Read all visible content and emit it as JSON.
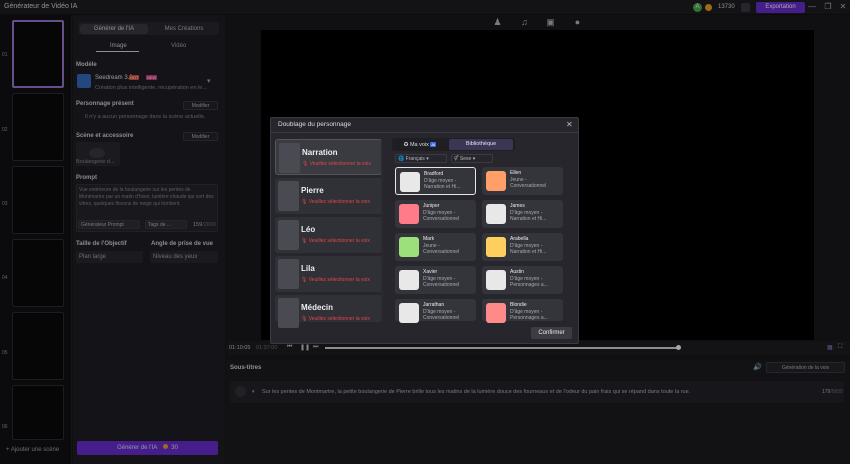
{
  "app": {
    "title": "Générateur de Vidéo IA",
    "avatar_letter": "A",
    "credits": "13730",
    "export_label": "Exportation"
  },
  "window": {
    "minimize": "—",
    "restore": "❐",
    "close": "✕"
  },
  "nav_icons": [
    "person-icon",
    "music-icon",
    "caption-icon",
    "sticker-icon"
  ],
  "left": {
    "scene_numbers": [
      "01",
      "02",
      "03",
      "04",
      "05",
      "06"
    ],
    "add_scene": "+ Ajouter une scène"
  },
  "panel": {
    "tabs": [
      "Générer de l'IA",
      "Mes Créations"
    ],
    "subtabs": [
      "Image",
      "Vidéo"
    ],
    "model_label": "Modèle",
    "model_name": "Seedream 3.0",
    "model_badge1": "HOT",
    "model_badge2": "NEW",
    "model_desc": "Création plus intelligente, récupération en le...",
    "char_label": "Personnage présent",
    "modify": "Modifier",
    "char_empty": "Il n'y a aucun personnage dans la scène actuelle.",
    "scene_label": "Scène et accessoire",
    "modify2": "Modifier",
    "boulangerie": "Boulangerie d...",
    "prompt_label": "Prompt",
    "prompt_text": "Vue extérieure de la boulangerie sur les pentes de Montmartre par un matin d'hiver, lumière chaude qui sort des vitres, quelques flocons de neige qui tombent.",
    "prompt_gen": "Générateur Prompt",
    "prompt_tags": "Tags de ...",
    "prompt_count": "159",
    "prompt_max": "/2000",
    "size_label": "Taille de l'Objectif",
    "angle_label": "Angle de prise de vue",
    "size_val": "Plan large",
    "angle_val": "Niveau des yeux",
    "gen_label": "Générer de l'IA",
    "gen_cost": "30"
  },
  "timeline": {
    "current": "01:10:05",
    "total": "01:37:00"
  },
  "subtitles": {
    "label": "Sous-titres",
    "voice_gen": "Génération de la voix",
    "text": "Sur les pentes de Montmartre, la petite boulangerie de Pierre brille tous les matins de la lumière douce des fourneaux et de l'odeur du pain frais qui se répand dans toute la rue.",
    "count": "179",
    "max": "/5000"
  },
  "modal": {
    "title": "Doublage du personnage",
    "close": "✕",
    "characters": [
      {
        "name": "Narration",
        "warn": "Veuillez sélectionner la voix"
      },
      {
        "name": "Pierre",
        "warn": "Veuillez sélectionner la voix"
      },
      {
        "name": "Léo",
        "warn": "Veuillez sélectionner la voix"
      },
      {
        "name": "Lila",
        "warn": "Veuillez sélectionner la voix"
      },
      {
        "name": "Médecin",
        "warn": "Veuillez sélectionner la voix"
      }
    ],
    "tab_mine": "Ma voix",
    "tab_mine_badge": "AI",
    "tab_lib": "Bibliothèque",
    "filter_lang": "Français",
    "filter_sex": "Sexe",
    "voices": [
      {
        "name": "Bradford",
        "l1": "D'âge moyen -",
        "l2": "Narration et Hi...",
        "color": "#e8e8e8"
      },
      {
        "name": "Ellen",
        "l1": "Jeune -",
        "l2": "Conversationnel",
        "color": "#ff9e66"
      },
      {
        "name": "Juniper",
        "l1": "D'âge moyen -",
        "l2": "Conversationnel",
        "color": "#ff7b8a"
      },
      {
        "name": "James",
        "l1": "D'âge moyen -",
        "l2": "Narration et Hi...",
        "color": "#e8e8e8"
      },
      {
        "name": "Mark",
        "l1": "Jeune -",
        "l2": "Conversationnel",
        "color": "#9be07a"
      },
      {
        "name": "Arabella",
        "l1": "D'âge moyen -",
        "l2": "Narration et Hi...",
        "color": "#ffcf5e"
      },
      {
        "name": "Xavier",
        "l1": "D'âge moyen -",
        "l2": "Conversationnel",
        "color": "#e8e8e8"
      },
      {
        "name": "Austin",
        "l1": "D'âge moyen -",
        "l2": "Personnages a...",
        "color": "#e8e8e8"
      },
      {
        "name": "Jarrathan",
        "l1": "D'âge moyen -",
        "l2": "Conversationnel",
        "color": "#e8e8e8"
      },
      {
        "name": "Blondie",
        "l1": "D'âge moyen -",
        "l2": "Personnages a...",
        "color": "#ff8a8a"
      }
    ],
    "confirm": "Confirmer"
  }
}
